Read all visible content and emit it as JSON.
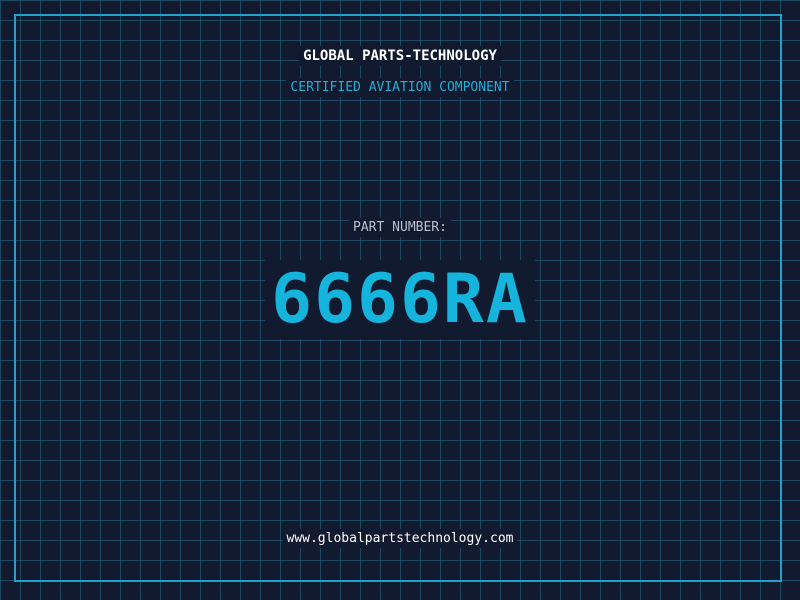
{
  "header": {
    "brand": "GLOBAL PARTS-TECHNOLOGY",
    "subtitle": "CERTIFIED AVIATION COMPONENT"
  },
  "part": {
    "label": "PART NUMBER:",
    "number": "6666RA"
  },
  "footer": {
    "website": "www.globalpartstechnology.com"
  },
  "colors": {
    "background": "#111a2e",
    "grid": "#266e8c",
    "accent": "#1fa3c9",
    "part_number": "#14b4dc",
    "text": "#ffffff"
  }
}
